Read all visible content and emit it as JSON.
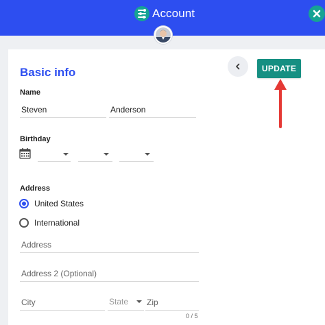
{
  "header": {
    "title": "Account",
    "title_icon": "sliders-icon",
    "close_icon": "close-icon",
    "bg_color": "#2d4ef0",
    "accent_color": "#16a394"
  },
  "actions": {
    "back_icon": "chevron-left-icon",
    "update_label": "UPDATE",
    "update_color": "#168f82"
  },
  "form": {
    "section_title": "Basic info",
    "name_label": "Name",
    "first_name": "Steven",
    "last_name": "Anderson",
    "birthday_label": "Birthday",
    "birthday_icon": "calendar-icon",
    "address_label": "Address",
    "address_types": [
      {
        "label": "United States",
        "selected": true
      },
      {
        "label": "International",
        "selected": false
      }
    ],
    "address_placeholder": "Address",
    "address2_placeholder": "Address 2 (Optional)",
    "city_placeholder": "City",
    "state_placeholder": "State",
    "zip_placeholder": "Zip",
    "zip_counter": "0 / 5"
  },
  "annotation": {
    "arrow_color": "#e53935"
  }
}
